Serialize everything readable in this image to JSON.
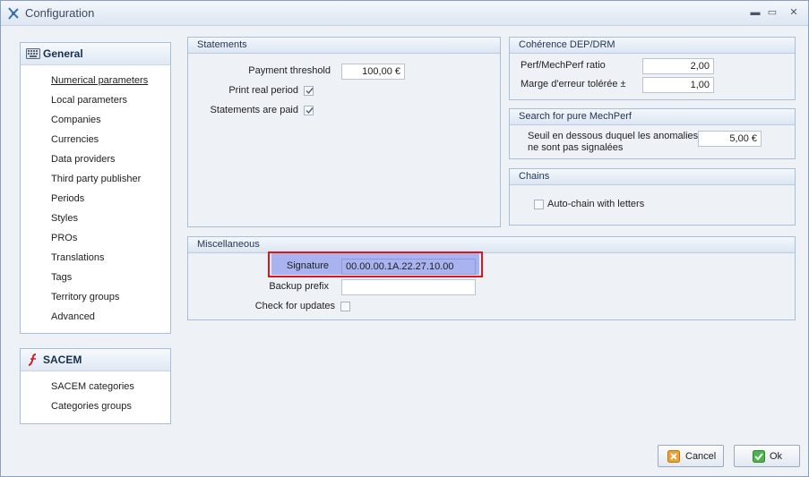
{
  "window": {
    "title": "Configuration",
    "minimize_glyph": "▬",
    "restore_glyph": "▭",
    "close_glyph": "✕"
  },
  "nav_general": {
    "title": "General",
    "items": [
      "Numerical parameters",
      "Local parameters",
      "Companies",
      "Currencies",
      "Data providers",
      "Third party publisher",
      "Periods",
      "Styles",
      "PROs",
      "Translations",
      "Tags",
      "Territory groups",
      "Advanced"
    ],
    "active_index": 0
  },
  "nav_sacem": {
    "title": "SACEM",
    "items": [
      "SACEM categories",
      "Categories groups"
    ]
  },
  "statements": {
    "title": "Statements",
    "payment_threshold_label": "Payment threshold",
    "payment_threshold_value": "100,00 €",
    "print_real_period_label": "Print real period",
    "print_real_period_checked": true,
    "statements_paid_label": "Statements are paid",
    "statements_paid_checked": true
  },
  "coherence": {
    "title": "Cohérence DEP/DRM",
    "ratio_label": "Perf/MechPerf ratio",
    "ratio_value": "2,00",
    "margin_label": "Marge d'erreur tolérée  ±",
    "margin_value": "1,00"
  },
  "mechperf": {
    "title": "Search for pure MechPerf",
    "threshold_label_line1": "Seuil en dessous duquel les anomalies",
    "threshold_label_line2": "ne sont pas signalées",
    "threshold_value": "5,00 €"
  },
  "chains": {
    "title": "Chains",
    "auto_chain_label": "Auto-chain with letters",
    "auto_chain_checked": false
  },
  "misc": {
    "title": "Miscellaneous",
    "signature_label": "Signature",
    "signature_value": "00.00.00.1A.22.27.10.00",
    "backup_prefix_label": "Backup prefix",
    "backup_prefix_value": "",
    "check_updates_label": "Check for updates",
    "check_updates_checked": false
  },
  "buttons": {
    "cancel": "Cancel",
    "ok": "Ok"
  },
  "colors": {
    "highlight": "#a9b3f0",
    "annotation_border": "#e0141c",
    "panel_header": "#dbe5f2"
  }
}
